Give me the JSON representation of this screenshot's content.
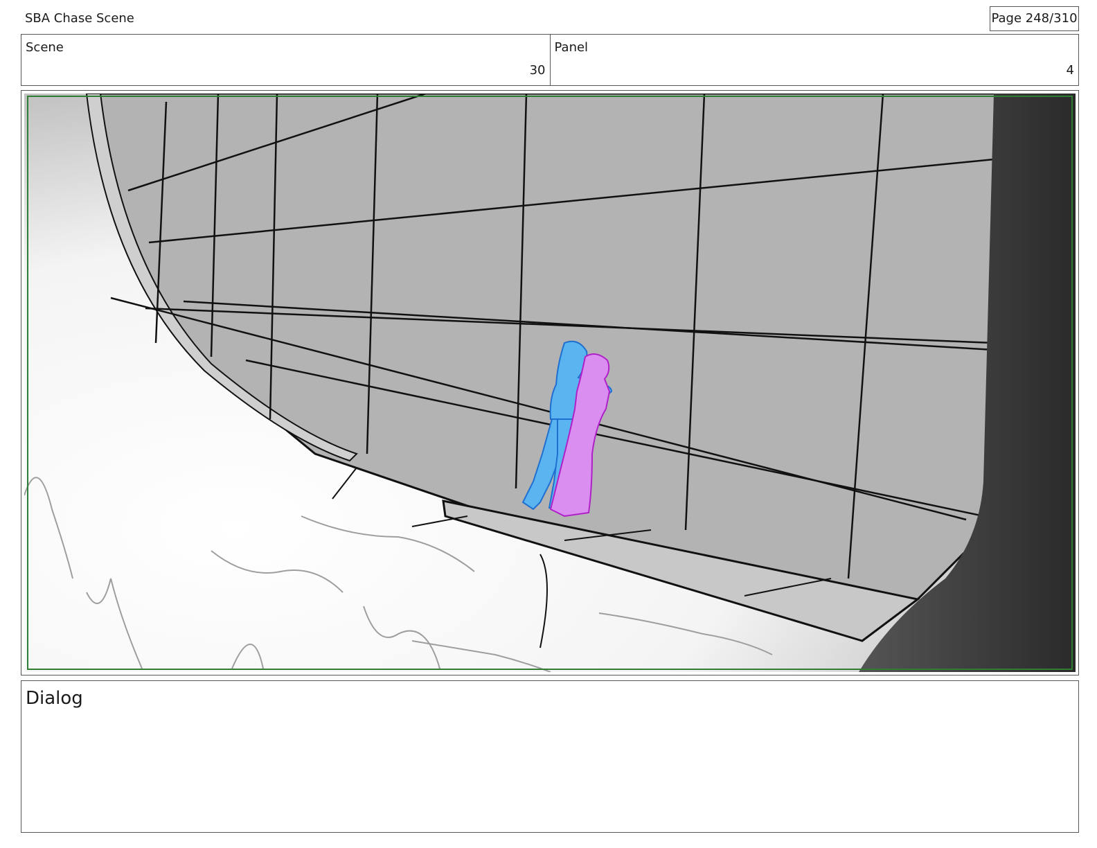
{
  "header": {
    "title": "SBA Chase Scene",
    "page": "Page 248/310"
  },
  "info": {
    "scene_label": "Scene",
    "scene_value": "30",
    "panel_label": "Panel",
    "panel_value": "4"
  },
  "panel": {
    "frame_border_color": "#2e7d32",
    "figure_left_color": "#5ab4f0",
    "figure_right_color": "#d98ef0"
  },
  "dialog": {
    "label": "Dialog"
  }
}
